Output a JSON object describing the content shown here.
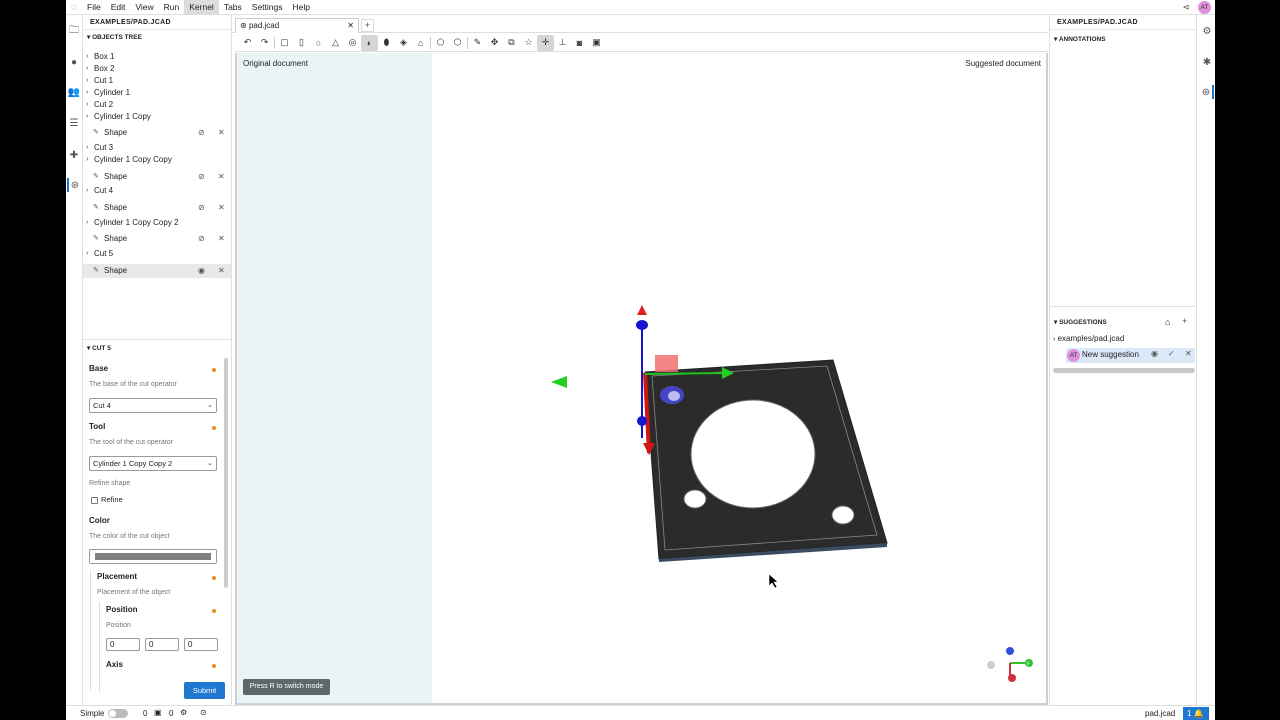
{
  "menubar": {
    "items": [
      "File",
      "Edit",
      "View",
      "Run",
      "Kernel",
      "Tabs",
      "Settings",
      "Help"
    ],
    "active": "Kernel",
    "avatar": "AT"
  },
  "left_panel": {
    "title": "EXAMPLES/PAD.JCAD",
    "objects_tree_title": "OBJECTS TREE",
    "tree": [
      {
        "label": "Box 1",
        "type": "object"
      },
      {
        "label": "Box 2",
        "type": "object"
      },
      {
        "label": "Cut 1",
        "type": "object"
      },
      {
        "label": "Cylinder 1",
        "type": "object"
      },
      {
        "label": "Cut 2",
        "type": "object"
      },
      {
        "label": "Cylinder 1 Copy",
        "type": "object"
      },
      {
        "label": "Shape",
        "type": "shape",
        "visible": false
      },
      {
        "label": "Cut 3",
        "type": "object"
      },
      {
        "label": "Cylinder 1 Copy Copy",
        "type": "object"
      },
      {
        "label": "Shape",
        "type": "shape",
        "visible": false
      },
      {
        "label": "Cut 4",
        "type": "object"
      },
      {
        "label": "Shape",
        "type": "shape",
        "visible": false
      },
      {
        "label": "Cylinder 1 Copy Copy 2",
        "type": "object"
      },
      {
        "label": "Shape",
        "type": "shape",
        "visible": false
      },
      {
        "label": "Cut 5",
        "type": "object"
      },
      {
        "label": "Shape",
        "type": "shape",
        "visible": true,
        "selected": true
      }
    ],
    "properties_title": "CUT 5",
    "base_title": "Base",
    "base_desc": "The base of the cut operator",
    "base_value": "Cut 4",
    "tool_title": "Tool",
    "tool_desc": "The tool of the cut operator",
    "tool_value": "Cylinder 1 Copy Copy 2",
    "refine_desc": "Refine shape",
    "refine_label": "Refine",
    "refine_checked": false,
    "color_title": "Color",
    "color_desc": "The color of the cut object",
    "color_value": "#808080",
    "placement_title": "Placement",
    "placement_desc": "Placement of the object",
    "position_title": "Position",
    "position_desc": "Position",
    "position_values": [
      "0",
      "0",
      "0"
    ],
    "axis_title": "Axis",
    "submit_label": "Submit"
  },
  "document": {
    "tab_label": "pad.jcad",
    "add_tab": "+",
    "original_label": "Original document",
    "suggested_label": "Suggested document",
    "hint": "Press R to switch mode"
  },
  "right_panel": {
    "title": "EXAMPLES/PAD.JCAD",
    "annotations_title": "ANNOTATIONS",
    "suggestions_title": "SUGGESTIONS",
    "suggestion_root": "examples/pad.jcad",
    "suggestion_item": "New suggestion",
    "suggestion_avatar": "AT"
  },
  "statusbar": {
    "mode_label": "Simple",
    "count1": "0",
    "count2": "0",
    "filename": "pad.jcad",
    "notifications": "1"
  },
  "colors": {
    "accent": "#1f77d0",
    "modified_dot": "#e98a1f",
    "original_pane": "#eaf3f6",
    "avatar": "#e091dd"
  }
}
